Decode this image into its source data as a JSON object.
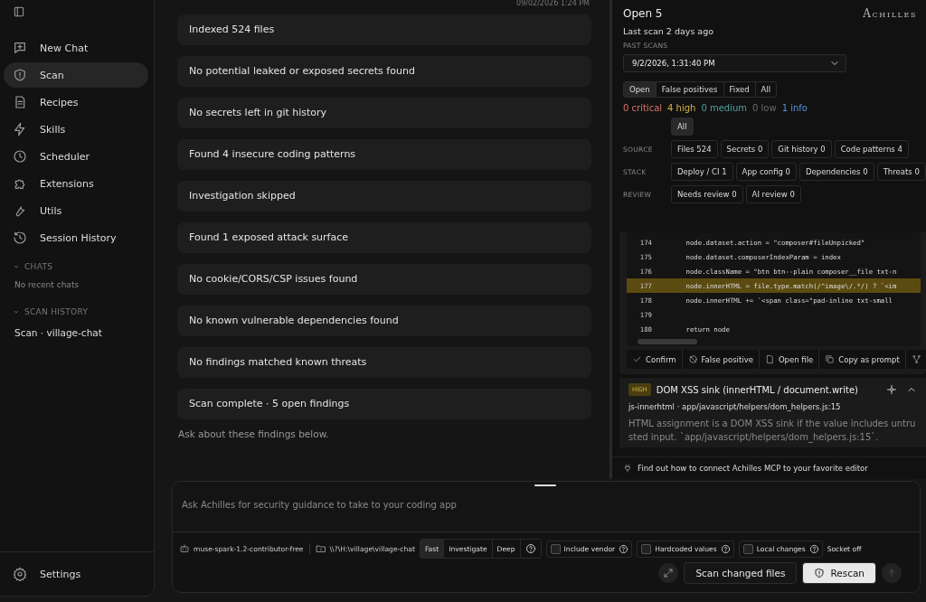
{
  "sidebar": {
    "items": [
      {
        "label": "New Chat",
        "selected": false
      },
      {
        "label": "Scan",
        "selected": true
      },
      {
        "label": "Recipes",
        "selected": false
      },
      {
        "label": "Skills",
        "selected": false
      },
      {
        "label": "Scheduler",
        "selected": false
      },
      {
        "label": "Extensions",
        "selected": false
      },
      {
        "label": "Utils",
        "selected": false
      },
      {
        "label": "Session History",
        "selected": false
      }
    ],
    "sections": [
      {
        "title": "CHATS",
        "expanded": true,
        "empty_text": "No recent chats"
      },
      {
        "title": "SCAN HISTORY",
        "expanded": true,
        "items": [
          "Scan · village-chat"
        ]
      }
    ],
    "settings": "Settings"
  },
  "timeline": {
    "timestamp": "09/02/2026 1:24 PM",
    "steps": [
      "Indexed 524 files",
      "No potential leaked or exposed secrets found",
      "No secrets left in git history",
      "Found 4 insecure coding patterns",
      "Investigation skipped",
      "Found 1 exposed attack surface",
      "No cookie/CORS/CSP issues found",
      "No known vulnerable dependencies found",
      "No findings matched known threats",
      "Scan complete · 5 open findings"
    ],
    "hint": "Ask about these findings below."
  },
  "panel": {
    "title": "Open 5",
    "logo": "Achilles",
    "last_scan": "Last scan 2 days ago",
    "past_scans_label": "PAST SCANS",
    "past_scan": "9/2/2026, 1:31:40 PM",
    "status_tabs": [
      {
        "label": "Open",
        "selected": true
      },
      {
        "label": "False positives",
        "selected": false
      },
      {
        "label": "Fixed",
        "selected": false
      },
      {
        "label": "All",
        "selected": false
      }
    ],
    "severities": [
      {
        "label": "0 critical",
        "color": "#d9736b"
      },
      {
        "label": "4 high",
        "color": "#d6b342"
      },
      {
        "label": "0 medium",
        "color": "#4fa39a"
      },
      {
        "label": "0 low",
        "color": "#6b6b6b"
      },
      {
        "label": "1 info",
        "color": "#5b8fe0"
      }
    ],
    "all_filter": {
      "label": "All",
      "selected": true
    },
    "filter_groups": [
      {
        "label": "SOURCE",
        "chips": [
          {
            "label": "Files 524",
            "selected": false
          },
          {
            "label": "Secrets 0",
            "selected": false
          },
          {
            "label": "Git history 0",
            "selected": false
          },
          {
            "label": "Code patterns 4",
            "selected": false
          }
        ]
      },
      {
        "label": "STACK",
        "chips": [
          {
            "label": "Deploy / CI 1",
            "selected": false
          },
          {
            "label": "App config 0",
            "selected": false
          },
          {
            "label": "Dependencies 0",
            "selected": false
          },
          {
            "label": "Threats 0",
            "selected": false
          }
        ]
      },
      {
        "label": "REVIEW",
        "chips": [
          {
            "label": "Needs review 0",
            "selected": false
          },
          {
            "label": "AI review 0",
            "selected": false
          }
        ]
      }
    ],
    "code": [
      {
        "line": "174",
        "text": "    node.dataset.action = \"composer#fileUnpicked\"",
        "highlighted": false
      },
      {
        "line": "175",
        "text": "    node.dataset.composerIndexParam = index",
        "highlighted": false
      },
      {
        "line": "176",
        "text": "    node.className = \"btn btn--plain composer__file txt-n",
        "highlighted": false
      },
      {
        "line": "177",
        "text": "    node.innerHTML = file.type.match(/^image\\/.*/) ? `<im",
        "highlighted": true
      },
      {
        "line": "178",
        "text": "    node.innerHTML += `<span class=\"pad-inline txt-small",
        "highlighted": false
      },
      {
        "line": "179",
        "highlighted": false
      },
      {
        "line": "180",
        "text": "    return node",
        "highlighted": false
      }
    ],
    "actions": [
      "Confirm",
      "False positive",
      "Open file",
      "Copy as prompt"
    ],
    "finding": {
      "severity": "HIGH",
      "title": "DOM XSS sink (innerHTML / document.write)",
      "expanded": true,
      "rule": "js-innerhtml · app/javascript/helpers/dom_helpers.js:15",
      "description": "HTML assignment is a DOM XSS sink if the value includes untrusted input. `app/javascript/helpers/dom_helpers.js:15`."
    },
    "mcp_hint": "Find out how to connect Achilles MCP to your favorite editor"
  },
  "composer": {
    "placeholder": "Ask Achilles for security guidance to take to your coding app",
    "model": "muse-spark-1.2-contributor-free",
    "path": "\\\\?\\H:\\village\\village-chat",
    "modes": [
      {
        "label": "Fast",
        "selected": true
      },
      {
        "label": "Investigate",
        "selected": false
      },
      {
        "label": "Deep",
        "selected": false
      }
    ],
    "options": [
      {
        "label": "Include vendor",
        "checked": false
      },
      {
        "label": "Hardcoded values",
        "checked": false
      },
      {
        "label": "Local changes",
        "checked": false
      }
    ],
    "socket": "Socket off",
    "secondary_button": "Scan changed files",
    "primary_button": "Rescan"
  }
}
